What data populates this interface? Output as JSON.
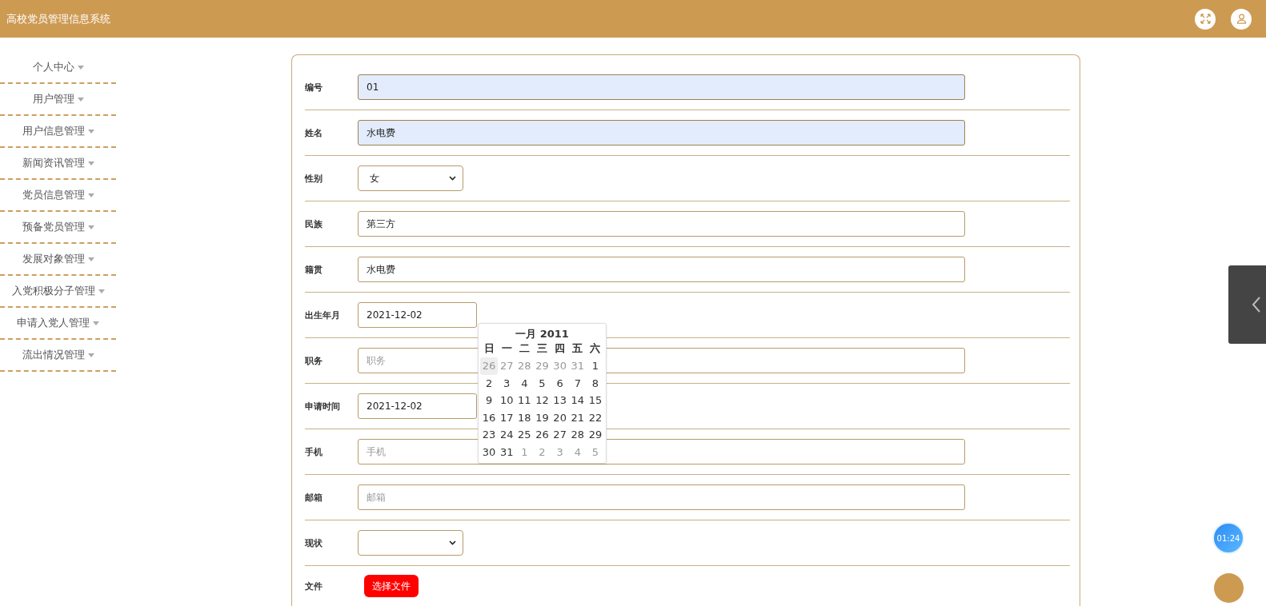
{
  "header": {
    "title": "高校党员管理信息系统"
  },
  "sidebar": {
    "items": [
      {
        "label": "个人中心"
      },
      {
        "label": "用户管理"
      },
      {
        "label": "用户信息管理"
      },
      {
        "label": "新闻资讯管理"
      },
      {
        "label": "党员信息管理"
      },
      {
        "label": "预备党员管理"
      },
      {
        "label": "发展对象管理"
      },
      {
        "label": "入党积极分子管理"
      },
      {
        "label": "申请入党人管理"
      },
      {
        "label": "流出情况管理"
      }
    ]
  },
  "form": {
    "fields": [
      {
        "label": "编号",
        "kind": "text",
        "value": "01",
        "autofilled": true
      },
      {
        "label": "姓名",
        "kind": "text",
        "value": "水电费",
        "autofilled": true
      },
      {
        "label": "性别",
        "kind": "select",
        "value": "女"
      },
      {
        "label": "民族",
        "kind": "text",
        "value": "第三方",
        "autofilled": false
      },
      {
        "label": "籍贯",
        "kind": "text",
        "value": "水电费",
        "autofilled": false
      },
      {
        "label": "出生年月",
        "kind": "date",
        "value": "2021-12-02",
        "picker_open": true
      },
      {
        "label": "职务",
        "kind": "text",
        "placeholder": "职务",
        "autofilled": false
      },
      {
        "label": "申请时间",
        "kind": "date",
        "value": "2021-12-02",
        "picker_open": false
      },
      {
        "label": "手机",
        "kind": "text",
        "placeholder": "手机",
        "autofilled": false
      },
      {
        "label": "邮箱",
        "kind": "text",
        "placeholder": "邮箱",
        "autofilled": false
      },
      {
        "label": "现状",
        "kind": "select"
      },
      {
        "label": "文件",
        "kind": "file",
        "button": "选择文件"
      }
    ]
  },
  "datepicker": {
    "title": "一月 2011",
    "weekdays": [
      "日",
      "一",
      "二",
      "三",
      "四",
      "五",
      "六"
    ],
    "weeks": [
      [
        {
          "text": "26",
          "muted": true,
          "hovered": true
        },
        {
          "text": "27",
          "muted": true,
          "hovered": false
        },
        {
          "text": "28",
          "muted": true,
          "hovered": false
        },
        {
          "text": "29",
          "muted": true,
          "hovered": false
        },
        {
          "text": "30",
          "muted": true,
          "hovered": false
        },
        {
          "text": "31",
          "muted": true,
          "hovered": false
        },
        {
          "text": "1",
          "muted": false,
          "hovered": false
        }
      ],
      [
        {
          "text": "2",
          "muted": false,
          "hovered": false
        },
        {
          "text": "3",
          "muted": false,
          "hovered": false
        },
        {
          "text": "4",
          "muted": false,
          "hovered": false
        },
        {
          "text": "5",
          "muted": false,
          "hovered": false
        },
        {
          "text": "6",
          "muted": false,
          "hovered": false
        },
        {
          "text": "7",
          "muted": false,
          "hovered": false
        },
        {
          "text": "8",
          "muted": false,
          "hovered": false
        }
      ],
      [
        {
          "text": "9",
          "muted": false,
          "hovered": false
        },
        {
          "text": "10",
          "muted": false,
          "hovered": false
        },
        {
          "text": "11",
          "muted": false,
          "hovered": false
        },
        {
          "text": "12",
          "muted": false,
          "hovered": false
        },
        {
          "text": "13",
          "muted": false,
          "hovered": false
        },
        {
          "text": "14",
          "muted": false,
          "hovered": false
        },
        {
          "text": "15",
          "muted": false,
          "hovered": false
        }
      ],
      [
        {
          "text": "16",
          "muted": false,
          "hovered": false
        },
        {
          "text": "17",
          "muted": false,
          "hovered": false
        },
        {
          "text": "18",
          "muted": false,
          "hovered": false
        },
        {
          "text": "19",
          "muted": false,
          "hovered": false
        },
        {
          "text": "20",
          "muted": false,
          "hovered": false
        },
        {
          "text": "21",
          "muted": false,
          "hovered": false
        },
        {
          "text": "22",
          "muted": false,
          "hovered": false
        }
      ],
      [
        {
          "text": "23",
          "muted": false,
          "hovered": false
        },
        {
          "text": "24",
          "muted": false,
          "hovered": false
        },
        {
          "text": "25",
          "muted": false,
          "hovered": false
        },
        {
          "text": "26",
          "muted": false,
          "hovered": false
        },
        {
          "text": "27",
          "muted": false,
          "hovered": false
        },
        {
          "text": "28",
          "muted": false,
          "hovered": false
        },
        {
          "text": "29",
          "muted": false,
          "hovered": false
        }
      ],
      [
        {
          "text": "30",
          "muted": false,
          "hovered": false
        },
        {
          "text": "31",
          "muted": false,
          "hovered": false
        },
        {
          "text": "1",
          "muted": true,
          "hovered": false
        },
        {
          "text": "2",
          "muted": true,
          "hovered": false
        },
        {
          "text": "3",
          "muted": true,
          "hovered": false
        },
        {
          "text": "4",
          "muted": true,
          "hovered": false
        },
        {
          "text": "5",
          "muted": true,
          "hovered": false
        }
      ]
    ]
  },
  "timer": {
    "text": "01:24"
  }
}
